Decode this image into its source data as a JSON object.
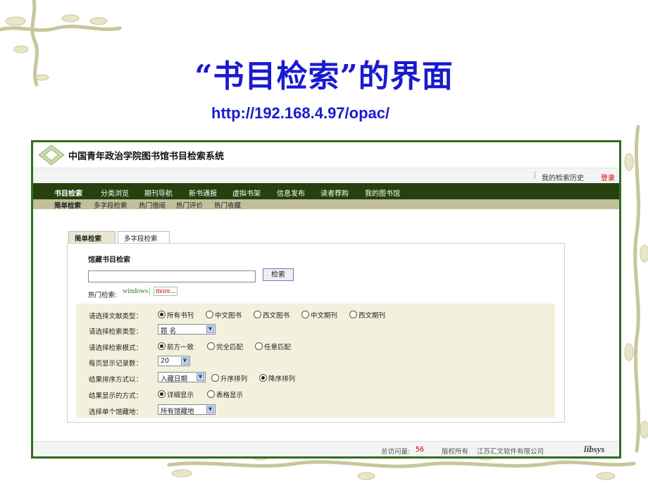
{
  "slide": {
    "title": "“书目检索”的界面",
    "url": "http://192.168.4.97/opac/"
  },
  "colors": {
    "title_blue": "#1a1ad0",
    "nav_green": "#26410e",
    "frame_green": "#2f6d1e"
  },
  "app": {
    "system_title": "中国青年政治学院图书馆书目检索系统",
    "topbar": {
      "separator": "|",
      "history": "我的检索历史",
      "login": "登录"
    },
    "nav": [
      "书目检索",
      "分类浏览",
      "期刊导航",
      "新书通报",
      "虚拟书架",
      "信息发布",
      "读者荐购",
      "我的图书馆"
    ],
    "subnav": [
      "简单检索",
      "多字段检索",
      "热门借阅",
      "热门评价",
      "热门收藏"
    ],
    "tabs": [
      "简单检索",
      "多字段检索"
    ],
    "panel": {
      "heading": "馆藏书目检索",
      "search_value": "",
      "search_button": "检索",
      "hot_label": "热门检索:",
      "hot_word": "windows",
      "more": "more..."
    },
    "options": {
      "doc_type": {
        "label": "请选择文献类型：",
        "choices": [
          "所有书刊",
          "中文图书",
          "西文图书",
          "中文期刊",
          "西文期刊"
        ],
        "selected": "所有书刊"
      },
      "search_type": {
        "label": "请选择检索类型：",
        "value": "题 名"
      },
      "search_mode": {
        "label": "请选择检索模式：",
        "choices": [
          "前方一致",
          "完全匹配",
          "任意匹配"
        ],
        "selected": "前方一致"
      },
      "page_size": {
        "label": "每页显示记录数：",
        "value": "20"
      },
      "sort": {
        "label": "结果排序方式以：",
        "value": "入藏日期",
        "choices": [
          "升序排列",
          "降序排列"
        ],
        "selected": "降序排列"
      },
      "display": {
        "label": "结果显示的方式：",
        "choices": [
          "详细显示",
          "表格显示"
        ],
        "selected": "详细显示"
      },
      "library": {
        "label": "选择单个馆藏地：",
        "value": "所有馆藏地"
      }
    },
    "footer": {
      "visits_label": "总访问量:",
      "visits": "56",
      "copyright": "版权所有",
      "company": "江苏汇文软件有限公司",
      "brand": "libsys"
    }
  }
}
